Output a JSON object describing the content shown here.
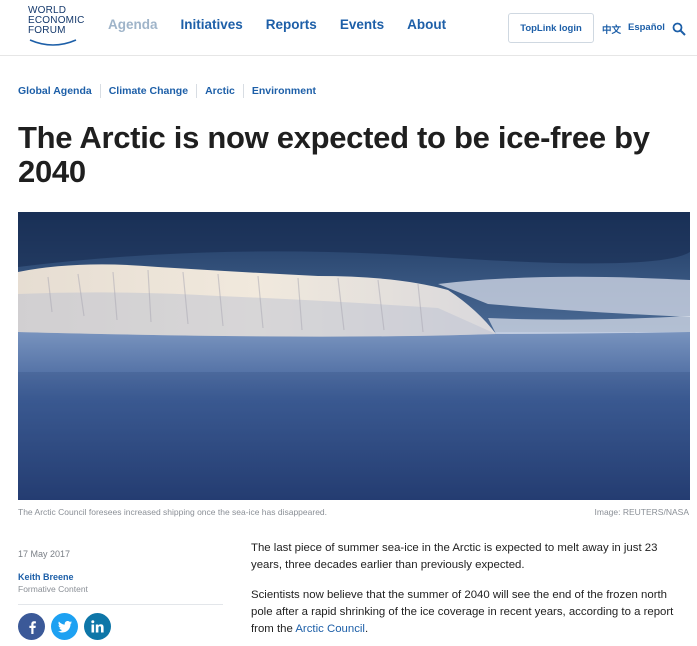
{
  "header": {
    "logo_lines": [
      "WORLD",
      "ECONOMIC",
      "FORUM"
    ],
    "nav": [
      "Agenda",
      "Initiatives",
      "Reports",
      "Events",
      "About"
    ],
    "login_label": "TopLink login",
    "lang_chinese": "中文",
    "lang_spanish": "Español",
    "search_icon": "search-icon"
  },
  "breadcrumbs": [
    "Global Agenda",
    "Climate Change",
    "Arctic",
    "Environment"
  ],
  "article": {
    "title": "The Arctic is now expected to be ice-free by 2040",
    "image_caption": "The Arctic Council foresees increased shipping once the sea-ice has disappeared.",
    "image_credit": "Image: REUTERS/NASA",
    "date": "17 May 2017",
    "author": "Keith Breene",
    "author_role": "Formative Content",
    "share_icons": [
      "facebook-icon",
      "twitter-icon",
      "linkedin-icon"
    ],
    "paragraph_1": "The last piece of summer sea-ice in the Arctic is expected to melt away in just 23 years, three decades earlier than previously expected.",
    "paragraph_2_text": "Scientists now believe that the summer of 2040 will see the end of the frozen north pole after a rapid shrinking of the ice coverage in recent years, according to a report from the ",
    "paragraph_2_link": "Arctic Council",
    "paragraph_2_end": "."
  },
  "colors": {
    "brand_blue": "#1d5fa8",
    "facebook": "#3b5998",
    "twitter": "#1da1f2",
    "linkedin": "#0e76a8"
  }
}
